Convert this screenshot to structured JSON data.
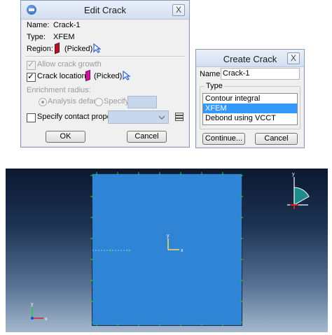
{
  "edit_crack": {
    "title": "Edit Crack",
    "close_glyph": "X",
    "name_label": "Name:",
    "name_value": "Crack-1",
    "type_label": "Type:",
    "type_value": "XFEM",
    "region_label": "Region:",
    "region_value": "(Picked)",
    "allow_growth_label": "Allow crack growth",
    "crack_location_label": "Crack location:",
    "crack_location_value": "(Picked)",
    "enrichment_radius_label": "Enrichment radius:",
    "analysis_default_label": "Analysis default",
    "specify_label": "Specify:",
    "specify_contact_label": "Specify contact property:",
    "ok_label": "OK",
    "cancel_label": "Cancel"
  },
  "create_crack": {
    "title": "Create Crack",
    "close_glyph": "X",
    "name_label": "Name:",
    "name_value": "Crack-1",
    "type_group_label": "Type",
    "type_options": [
      "Contour integral",
      "XFEM",
      "Debond using VCCT"
    ],
    "selected_option": "XFEM",
    "continue_label": "Continue...",
    "cancel_label": "Cancel"
  },
  "viewport": {
    "triad_center_x": "x",
    "triad_center_y": "y",
    "triad_corner_x": "x",
    "triad_corner_y": "y",
    "triad_top_y": "y",
    "part_color": "#2f84d6"
  },
  "icons": [
    "system-menu-icon",
    "close-icon",
    "part-region-icon",
    "pick-arrow-icon",
    "dropdown-chevron-icon",
    "property-manager-icon"
  ]
}
